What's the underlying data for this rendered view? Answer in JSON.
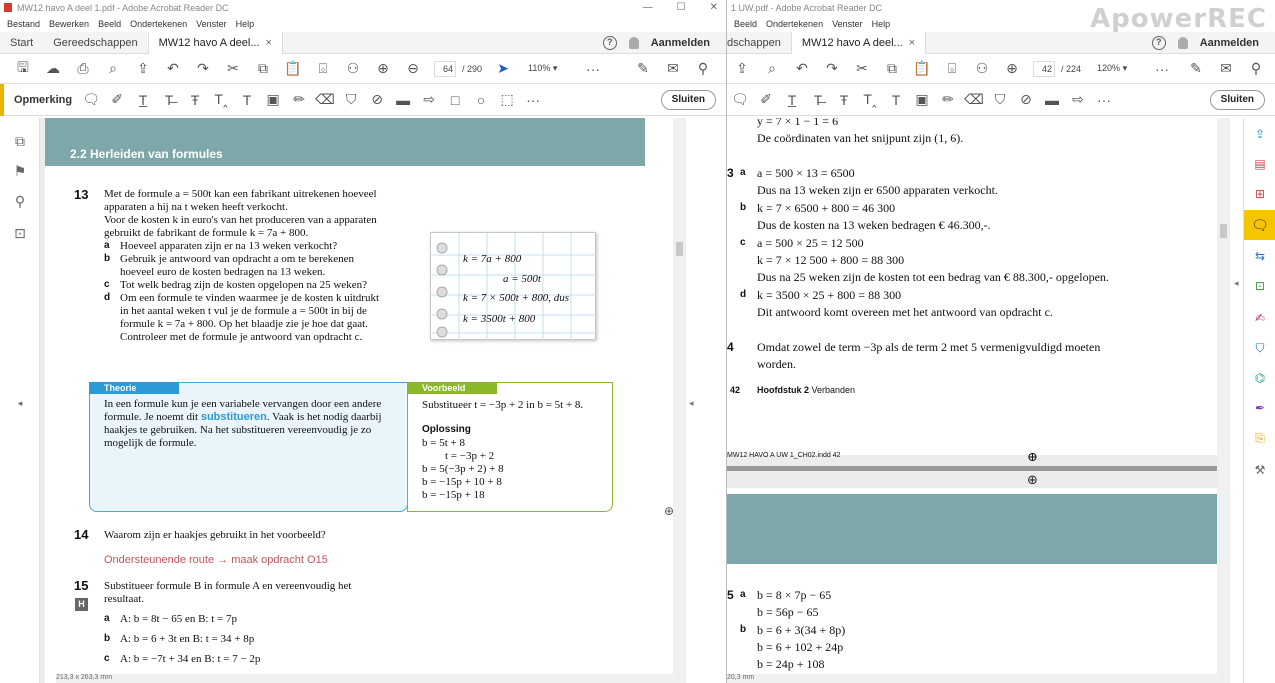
{
  "left": {
    "title": "MW12 havo A deel 1.pdf - Adobe Acrobat Reader DC",
    "menu": [
      "Bestand",
      "Bewerken",
      "Beeld",
      "Ondertekenen",
      "Venster",
      "Help"
    ],
    "tabs": {
      "start": "Start",
      "tools": "Gereedschappen",
      "doc": "MW12 havo A deel...",
      "close": "×"
    },
    "signin": "Aanmelden",
    "page_current": "64",
    "page_total": "/ 290",
    "zoom": "110%",
    "comment_label": "Opmerking",
    "close_button": "Sluiten",
    "status": "213,3 x 263,3 mm",
    "content": {
      "section": "2.2   Herleiden van formules",
      "q13_num": "13",
      "q13_lines": [
        "Met de formule a = 500t kan een fabrikant uitrekenen hoeveel",
        "apparaten a hij na t weken heeft verkocht.",
        "Voor de kosten k in euro's van het produceren van a apparaten",
        "gebruikt de fabrikant de formule k = 7a + 800."
      ],
      "q13_a": [
        "a",
        "Hoeveel apparaten zijn er na 13 weken verkocht?"
      ],
      "q13_b": [
        "b",
        "Gebruik je antwoord van opdracht a om te berekenen",
        "hoeveel euro de kosten bedragen na 13 weken."
      ],
      "q13_c": [
        "c",
        "Tot welk bedrag zijn de kosten opgelopen na 25 weken?"
      ],
      "q13_d": [
        "d",
        "Om een formule te vinden waarmee je de kosten k uitdrukt",
        "in het aantal weken t vul je de formule a = 500t in bij de",
        "formule k = 7a + 800. Op het blaadje zie je hoe dat gaat.",
        "Controleer met de formule je antwoord van opdracht c."
      ],
      "note": [
        "k = 7a + 800",
        "a = 500t",
        "k = 7 × 500t + 800, dus",
        "k = 3500t + 800"
      ],
      "theory_label": "Theorie",
      "theory_lines": [
        "In een formule kun je een variabele vervangen door een andere",
        "formule. Je noemt dit ",
        "substitueren",
        ". Vaak is het nodig daarbij",
        "haakjes te gebruiken. Na het substitueren vereenvoudig je zo",
        "mogelijk de formule."
      ],
      "example_label": "Voorbeeld",
      "example_intro": "Substitueer t = −3p + 2 in b = 5t + 8.",
      "solution_label": "Oplossing",
      "solution_lines": [
        "b = 5t + 8",
        "t = −3p + 2",
        "b = 5(−3p + 2) + 8",
        "b = −15p + 10 + 8",
        "b = −15p + 18"
      ],
      "q14_num": "14",
      "q14_text": "Waarom zijn er haakjes gebruikt in het voorbeeld?",
      "route": "Ondersteunende route → maak opdracht O15",
      "q15_num": "15",
      "q15_badge": "H",
      "q15_lines": [
        "Substitueer formule B in formule A en vereenvoudig het",
        "resultaat."
      ],
      "q15_a": [
        "a",
        "A: b = 8t − 65 en B: t = 7p"
      ],
      "q15_b": [
        "b",
        "A: b = 6 + 3t en B: t = 34 + 8p"
      ],
      "q15_c": [
        "c",
        "A: b = −7t + 34 en B: t = 7 − 2p"
      ]
    }
  },
  "right": {
    "title": "1 UW.pdf - Adobe Acrobat Reader DC",
    "menu": [
      "Beeld",
      "Ondertekenen",
      "Venster",
      "Help"
    ],
    "tabs": {
      "tools": "dschappen",
      "doc": "MW12 havo A deel...",
      "close": "×"
    },
    "signin": "Aanmelden",
    "page_current": "42",
    "page_total": "/ 224",
    "zoom": "120%",
    "close_button": "Sluiten",
    "status": "20,3 mm",
    "watermark": "ApowerREC",
    "content": {
      "top_line": "y = 7 × 1 − 1 = 6",
      "coord": "De coördinaten van het snijpunt zijn (1, 6).",
      "a13": [
        [
          "3",
          "a",
          "a = 500 × 13 = 6500"
        ],
        [
          "",
          "",
          "Dus na 13 weken zijn er 6500 apparaten verkocht."
        ],
        [
          "",
          "b",
          "k = 7 × 6500 + 800 = 46 300"
        ],
        [
          "",
          "",
          "Dus de kosten na 13 weken bedragen € 46.300,-."
        ],
        [
          "",
          "c",
          "a = 500 × 25 = 12 500"
        ],
        [
          "",
          "",
          "k = 7 × 12 500 + 800 = 88 300"
        ],
        [
          "",
          "",
          "Dus na 25 weken zijn de kosten tot een bedrag van € 88.300,- opgelopen."
        ],
        [
          "",
          "d",
          "k = 3500 × 25 + 800 = 88 300"
        ],
        [
          "",
          "",
          "Dit antwoord komt overeen met het antwoord van opdracht c."
        ]
      ],
      "a14": [
        "4",
        "Omdat zowel de term −3p als de term 2 met 5 vermenigvuldigd moeten",
        "worden."
      ],
      "footer_num": "42",
      "footer_text": "Hoofdstuk 2 ",
      "footer_text2": "Verbanden",
      "indd": "MW12 HAVO A UW 1_CH02.indd   42",
      "a15": [
        [
          "5",
          "a",
          "b = 8 × 7p − 65"
        ],
        [
          "",
          "",
          "b = 56p − 65"
        ],
        [
          "",
          "b",
          "b = 6 + 3(34 + 8p)"
        ],
        [
          "",
          "",
          "b = 6 + 102 + 24p"
        ],
        [
          "",
          "",
          "b = 24p + 108"
        ]
      ]
    }
  }
}
